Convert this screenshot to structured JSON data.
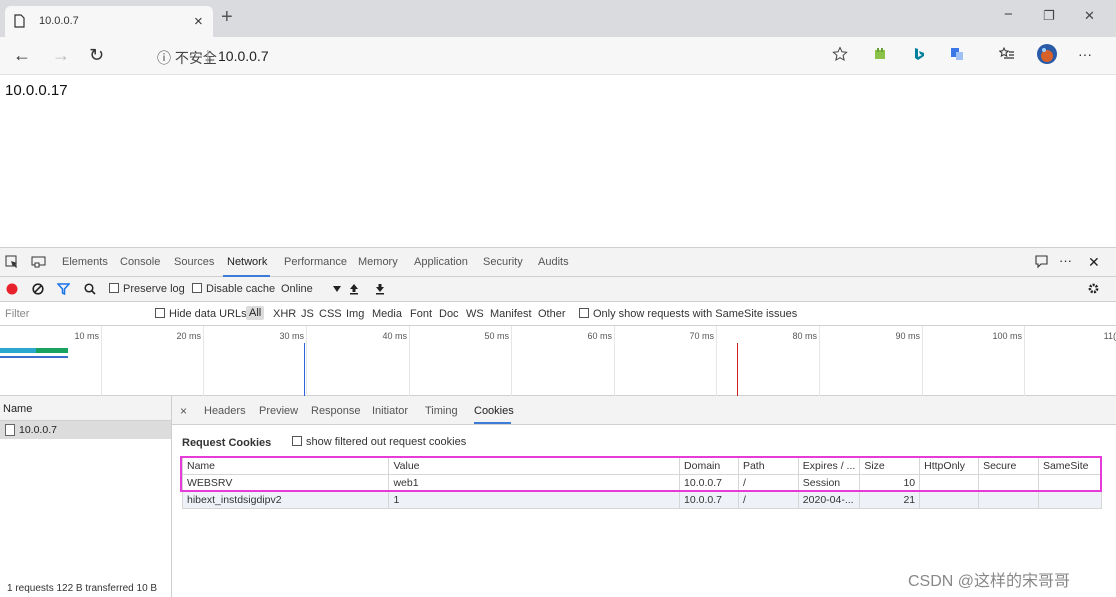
{
  "browser": {
    "tab_title": "10.0.0.7",
    "tab_close": "×",
    "new_tab": "+",
    "window": {
      "minimize": "−",
      "restore": "❐",
      "close": "✕"
    },
    "back": "←",
    "forward": "→",
    "reload": "↻",
    "security": "ⓘ 不安全",
    "separator": "|",
    "url": "10.0.0.7",
    "menu": "···"
  },
  "page": {
    "text": "10.0.0.17"
  },
  "devtools": {
    "tabs": [
      "Elements",
      "Console",
      "Sources",
      "Network",
      "Performance",
      "Memory",
      "Application",
      "Security",
      "Audits"
    ],
    "active_tab": "Network",
    "more": "···",
    "close": "✕",
    "toolbar": {
      "preserve_log": "Preserve log",
      "disable_cache": "Disable cache",
      "throttle": "Online"
    },
    "filter": {
      "placeholder": "Filter",
      "hide_data_urls": "Hide data URLs",
      "types": [
        "All",
        "XHR",
        "JS",
        "CSS",
        "Img",
        "Media",
        "Font",
        "Doc",
        "WS",
        "Manifest",
        "Other"
      ],
      "samesite": "Only show requests with SameSite issues"
    },
    "timeline": {
      "ticks": [
        "10 ms",
        "20 ms",
        "30 ms",
        "40 ms",
        "50 ms",
        "60 ms",
        "70 ms",
        "80 ms",
        "90 ms",
        "100 ms",
        "11("
      ]
    },
    "requests": {
      "header": "Name",
      "rows": [
        "10.0.0.7"
      ],
      "status": "1 requests  122 B transferred  10 B"
    },
    "detail": {
      "close": "×",
      "tabs": [
        "Headers",
        "Preview",
        "Response",
        "Initiator",
        "Timing",
        "Cookies"
      ],
      "active_tab": "Cookies",
      "section_title": "Request Cookies",
      "show_filtered": "show filtered out request cookies",
      "columns": [
        "Name",
        "Value",
        "Domain",
        "Path",
        "Expires / ...",
        "Size",
        "HttpOnly",
        "Secure",
        "SameSite"
      ],
      "cookies": [
        [
          "WEBSRV",
          "web1",
          "10.0.0.7",
          "/",
          "Session",
          "10",
          "",
          "",
          ""
        ],
        [
          "hibext_instdsigdipv2",
          "1",
          "10.0.0.7",
          "/",
          "2020-04-...",
          "21",
          "",
          "",
          ""
        ]
      ]
    }
  },
  "watermark": "CSDN @这样的宋哥哥",
  "colors": {
    "highlight": "#e63ad9",
    "accent": "#3c7bd6",
    "record": "#e8222c",
    "filter_icon": "#1a73e8"
  }
}
